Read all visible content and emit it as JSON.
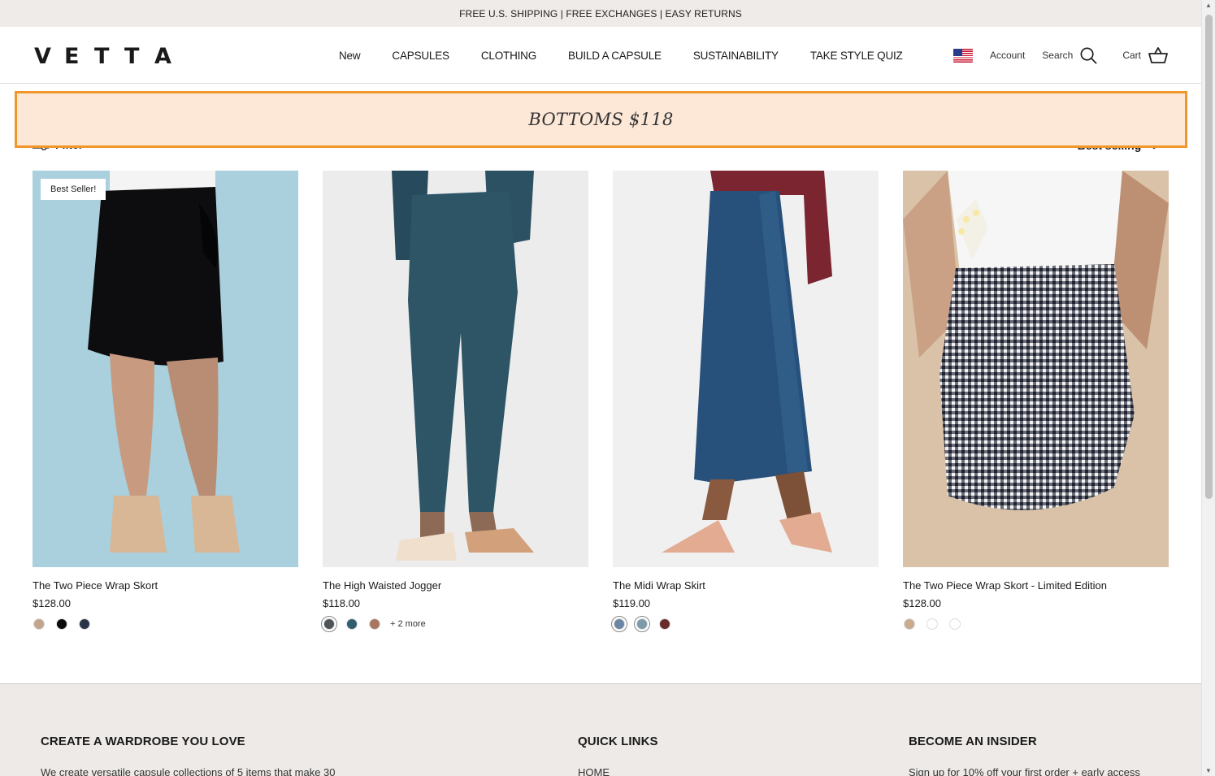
{
  "announcement": "FREE U.S. SHIPPING | FREE EXCHANGES | EASY RETURNS",
  "logo": [
    "V",
    "E",
    "T",
    "T",
    "A"
  ],
  "nav": [
    "New",
    "CAPSULES",
    "CLOTHING",
    "BUILD A CAPSULE",
    "SUSTAINABILITY",
    "TAKE STYLE QUIZ"
  ],
  "utils": {
    "account": "Account",
    "search": "Search",
    "cart": "Cart"
  },
  "banner": "BOTTOMS $118",
  "toolbar": {
    "filter": "Filter",
    "sort": "Best selling"
  },
  "products": [
    {
      "name": "The Two Piece Wrap Skort",
      "price": "$128.00",
      "badge": "Best Seller!",
      "swatches": [
        "#c4a48c",
        "#0b0b0b",
        "#2b3348"
      ],
      "more": ""
    },
    {
      "name": "The High Waisted Jogger",
      "price": "$118.00",
      "badge": "",
      "swatches": [
        "#4f5457",
        "#2f5f6e",
        "#a97560"
      ],
      "more": "+ 2 more"
    },
    {
      "name": "The Midi Wrap Skirt",
      "price": "$119.00",
      "badge": "",
      "swatches": [
        "#6c86a3",
        "#7d9aa6",
        "#6b2a2a"
      ],
      "more": ""
    },
    {
      "name": "The Two Piece Wrap Skort - Limited Edition",
      "price": "$128.00",
      "badge": "",
      "swatches": [
        "#c9ab8e",
        "#ffffff",
        "#ffffff"
      ],
      "more": ""
    }
  ],
  "footer": {
    "col1": {
      "heading": "CREATE A WARDROBE YOU LOVE",
      "text": "We create versatile capsule collections of 5 items that make 30"
    },
    "col2": {
      "heading": "QUICK LINKS",
      "text": "HOME"
    },
    "col3": {
      "heading": "BECOME AN INSIDER",
      "text": "Sign up for 10% off your first order + early access"
    }
  },
  "colors": {
    "announcement_bg": "#efebe8",
    "banner_bg": "#fde7d7",
    "banner_border": "#f0962a",
    "footer_bg": "#eeeae7"
  }
}
